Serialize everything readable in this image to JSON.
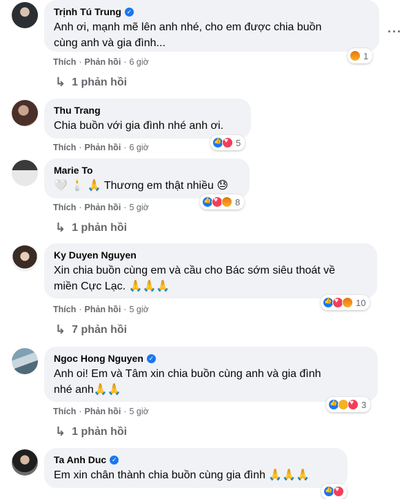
{
  "labels": {
    "like": "Thích",
    "reply": "Phản hồi",
    "dot": "·"
  },
  "more_icon": "more-horizontal-icon",
  "comments": [
    {
      "author": "Trịnh Tú Trung",
      "verified": true,
      "text_line1": "Anh ơi, mạnh mẽ lên anh nhé, cho em được chia buồn",
      "text_line2": "cùng anh và gia đình...",
      "time": "6 giờ",
      "reaction_count": "1",
      "reactions": [
        "angry"
      ],
      "replies": "1 phản hồi"
    },
    {
      "author": "Thu Trang",
      "verified": false,
      "text_line1": "Chia buồn với gia đình nhé anh ơi.",
      "time": "6 giờ",
      "reaction_count": "5",
      "reactions": [
        "like",
        "love"
      ]
    },
    {
      "author": "Marie To",
      "verified": false,
      "text_line1": "🤍 🕯️ 🙏 Thương em thật nhiều 😓",
      "time": "5 giờ",
      "reaction_count": "8",
      "reactions": [
        "like",
        "love",
        "angry"
      ],
      "replies": "1 phản hồi"
    },
    {
      "author": "Ky Duyen Nguyen",
      "verified": false,
      "text_line1": "Xin chia buồn cùng em và cầu cho Bác sớm siêu thoát về",
      "text_line2": "miền Cực Lạc. 🙏🙏🙏",
      "time": "5 giờ",
      "reaction_count": "10",
      "reactions": [
        "like",
        "love",
        "angry"
      ],
      "replies": "7 phản hồi"
    },
    {
      "author": "Ngoc Hong Nguyen",
      "verified": true,
      "text_line1": "Anh oi! Em và Tâm xin chia buồn cùng anh và gia đình",
      "text_line2": "nhé anh🙏🙏",
      "time": "5 giờ",
      "reaction_count": "3",
      "reactions": [
        "like",
        "care",
        "love"
      ],
      "replies": "1 phản hồi"
    },
    {
      "author": "Ta Anh Duc",
      "verified": true,
      "text_line1": "Em xin chân thành chia buồn cùng gia đình 🙏🙏🙏"
    }
  ]
}
